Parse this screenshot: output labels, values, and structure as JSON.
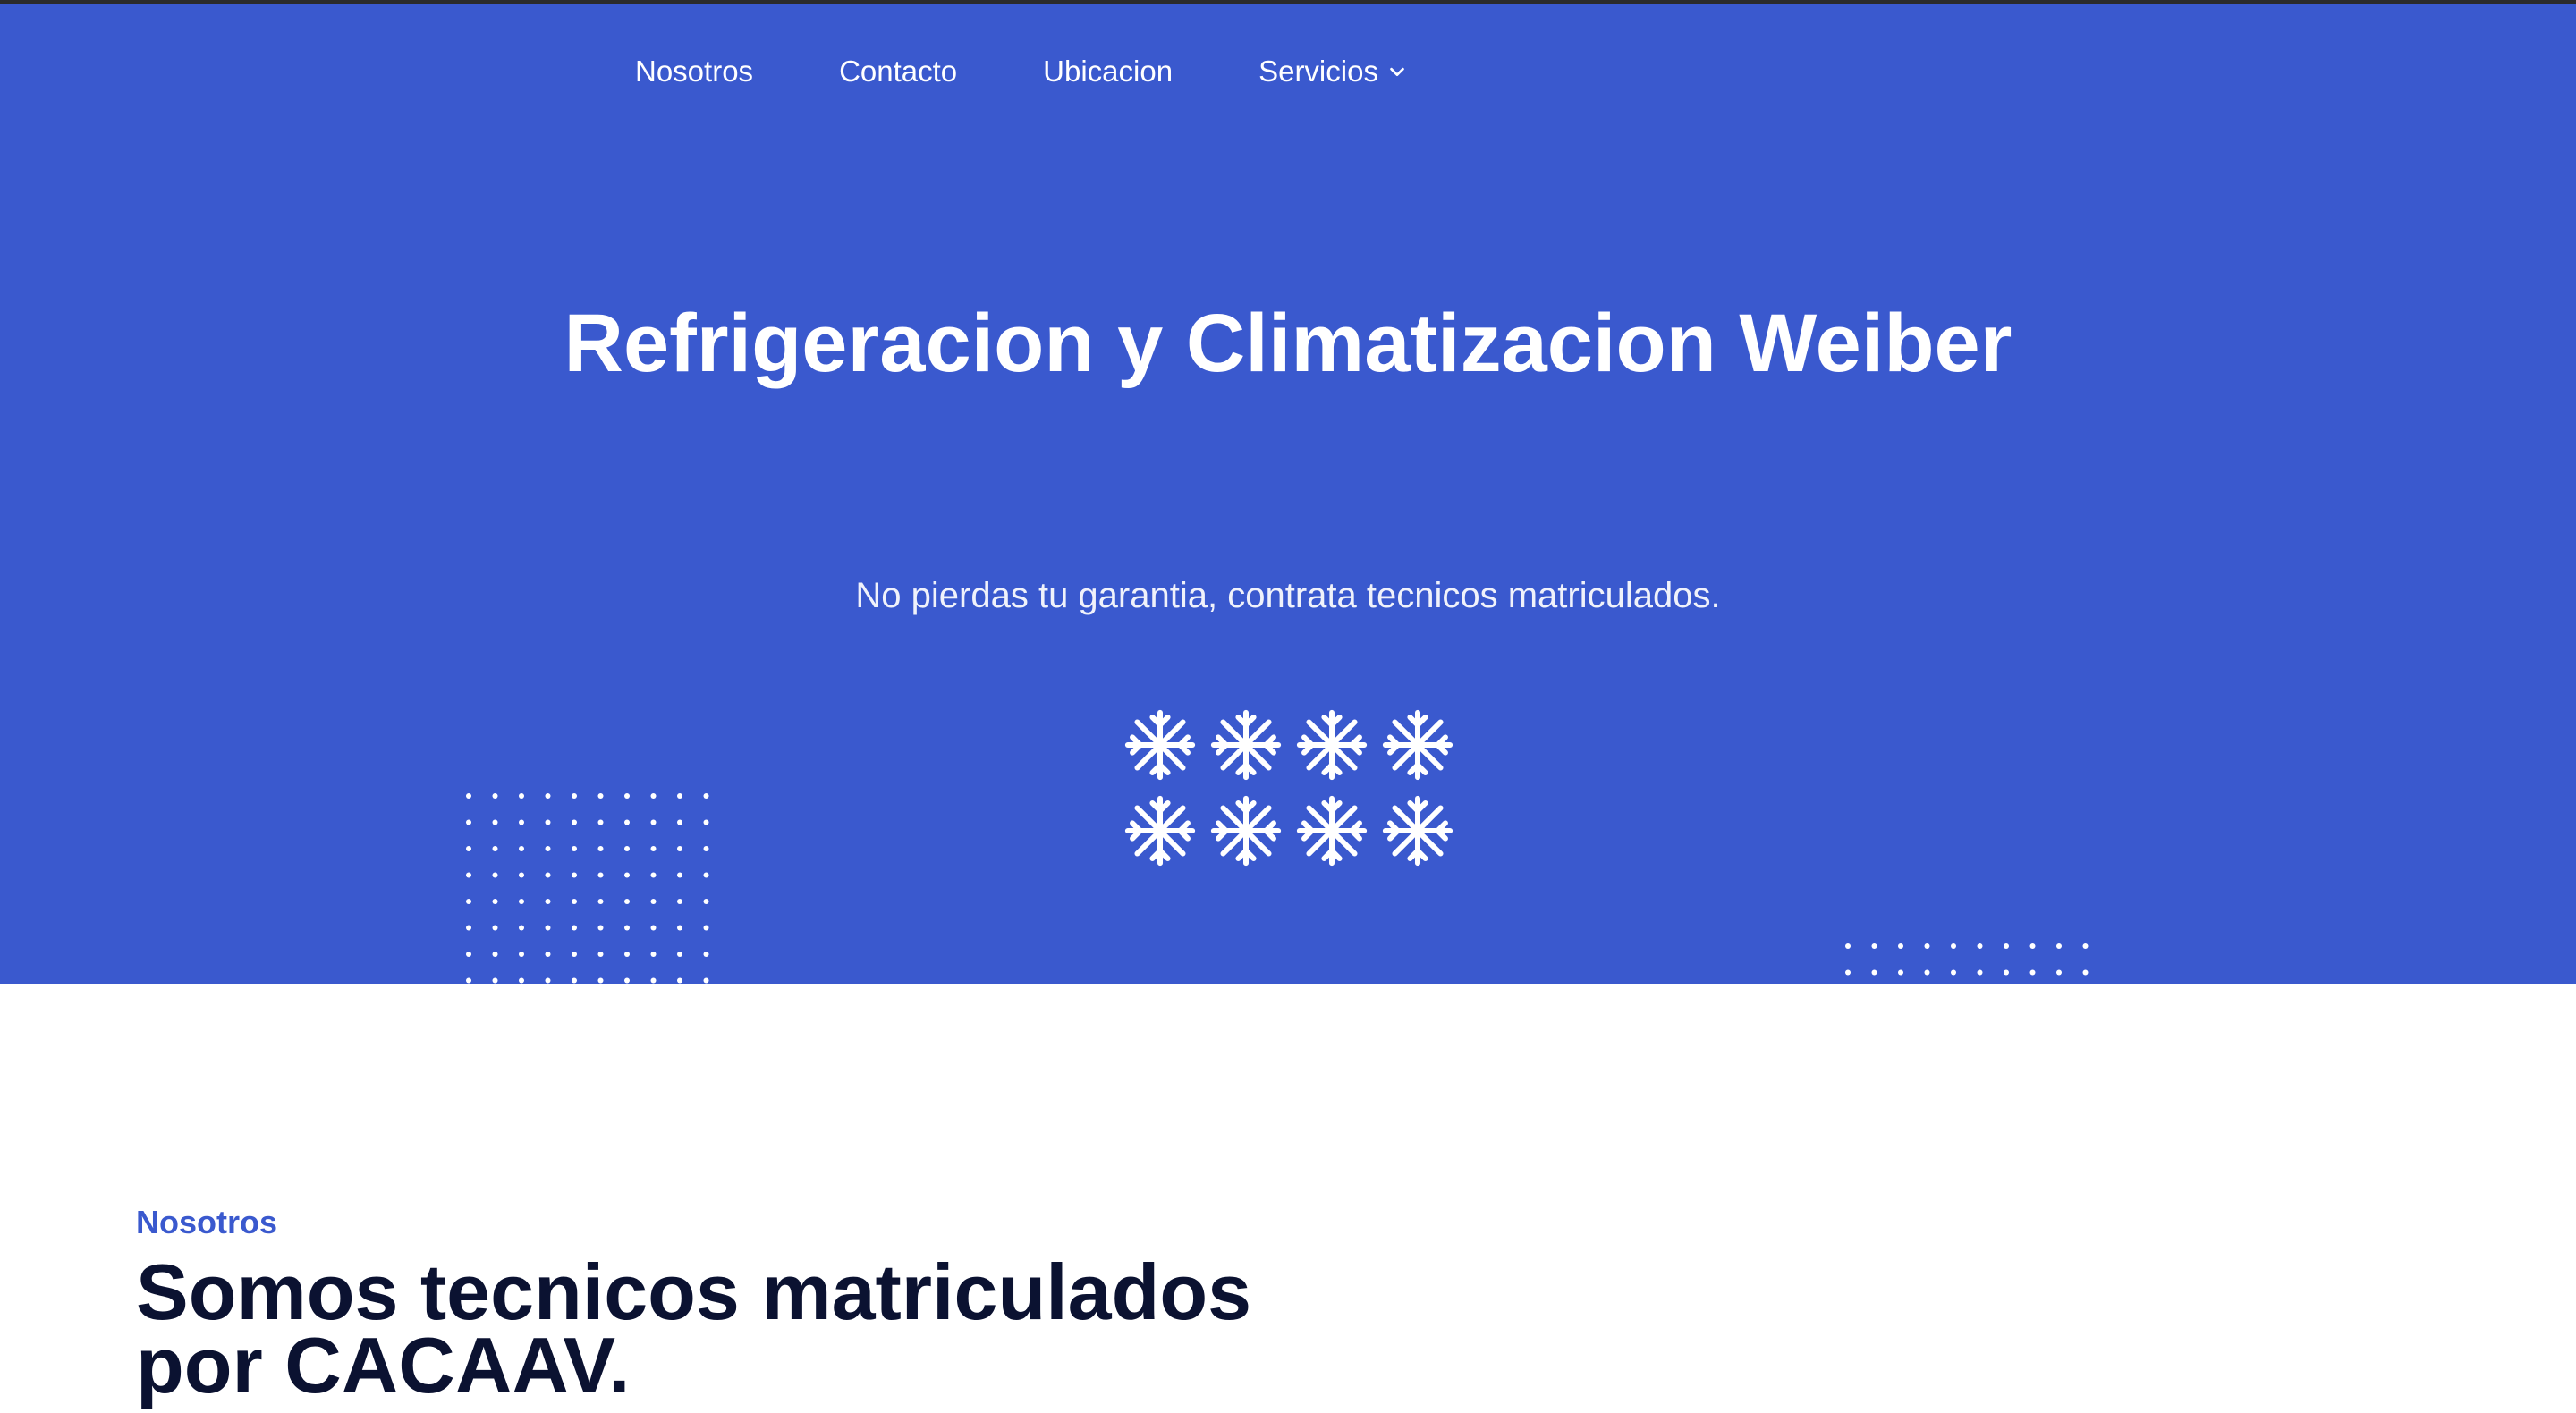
{
  "nav": {
    "items": [
      {
        "label": "Nosotros"
      },
      {
        "label": "Contacto"
      },
      {
        "label": "Ubicacion"
      },
      {
        "label": "Servicios",
        "has_dropdown": true
      }
    ]
  },
  "hero": {
    "title": "Refrigeracion y Climatizacion Weiber",
    "subtitle": "No pierdas tu garantia, contrata tecnicos matriculados.",
    "icon": "snowflake-icon",
    "icon_count": 8
  },
  "about": {
    "eyebrow": "Nosotros",
    "title": "Somos tecnicos matriculados por CACAAV."
  },
  "colors": {
    "primary": "#3a59ce",
    "heading_dark": "#0b1231",
    "white": "#ffffff"
  }
}
